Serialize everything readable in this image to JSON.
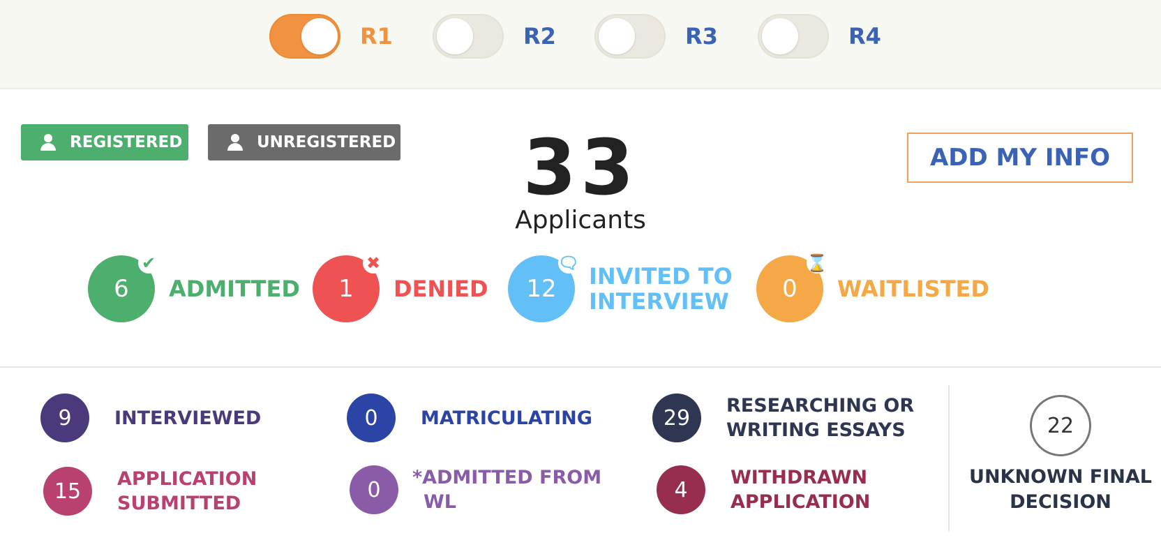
{
  "rounds": [
    {
      "label": "R1",
      "on": true
    },
    {
      "label": "R2",
      "on": false
    },
    {
      "label": "R3",
      "on": false
    },
    {
      "label": "R4",
      "on": false
    }
  ],
  "filters": {
    "registered_label": "REGISTERED",
    "unregistered_label": "UNREGISTERED"
  },
  "summary": {
    "total": "33",
    "total_label": "Applicants",
    "add_info_label": "ADD MY INFO"
  },
  "decisions": [
    {
      "count": "6",
      "label_line1": "ADMITTED",
      "label_line2": "",
      "color": "#4caf6e",
      "label_color": "#4caf6e",
      "badge_icon": "check-icon",
      "badge_glyph": "✔"
    },
    {
      "count": "1",
      "label_line1": "DENIED",
      "label_line2": "",
      "color": "#ee5253",
      "label_color": "#ee5253",
      "badge_icon": "x-icon",
      "badge_glyph": "✖"
    },
    {
      "count": "12",
      "label_line1": "INVITED TO",
      "label_line2": "INTERVIEW",
      "color": "#62c0f6",
      "label_color": "#62c0f6",
      "badge_icon": "chat-bubble-icon",
      "badge_glyph": "🗨"
    },
    {
      "count": "0",
      "label_line1": "WAITLISTED",
      "label_line2": "",
      "color": "#f4a846",
      "label_color": "#f4a846",
      "badge_icon": "hourglass-icon",
      "badge_glyph": "⌛"
    }
  ],
  "statuses": [
    {
      "count": "9",
      "label_line1": "INTERVIEWED",
      "label_line2": "",
      "color": "#4a3a7c",
      "label_color": "#4a3a7c"
    },
    {
      "count": "0",
      "label_line1": "MATRICULATING",
      "label_line2": "",
      "color": "#2b44a6",
      "label_color": "#2b44a6"
    },
    {
      "count": "29",
      "label_line1": "RESEARCHING OR",
      "label_line2": "WRITING ESSAYS",
      "color": "#2e3652",
      "label_color": "#2e3652"
    },
    {
      "count": "15",
      "label_line1": "APPLICATION",
      "label_line2": "SUBMITTED",
      "color": "#b8416f",
      "label_color": "#b8416f"
    },
    {
      "count": "0",
      "label_line1": "*ADMITTED FROM",
      "label_line2": "WL",
      "color": "#8a5ca8",
      "label_color": "#8a5ca8"
    },
    {
      "count": "4",
      "label_line1": "WITHDRAWN",
      "label_line2": "APPLICATION",
      "color": "#982e4e",
      "label_color": "#982e4e"
    }
  ],
  "unknown": {
    "count": "22",
    "label_line1": "UNKNOWN FINAL",
    "label_line2": "DECISION"
  }
}
